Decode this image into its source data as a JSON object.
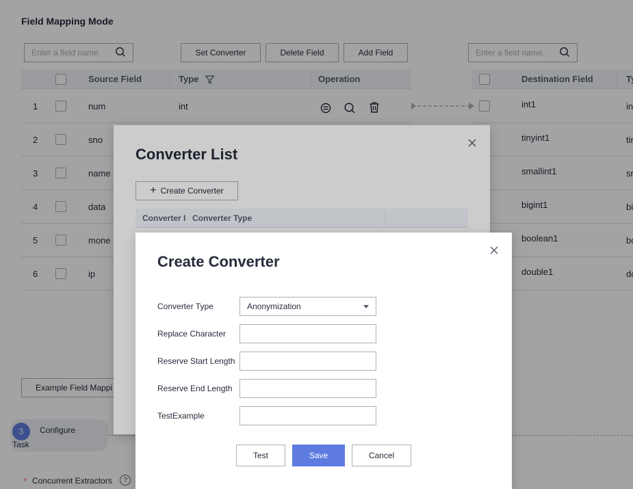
{
  "page": {
    "title": "Field Mapping Mode",
    "source_search_placeholder": "Enter a field name.",
    "dest_search_placeholder": "Enter a field name.",
    "toolbar": {
      "set_converter": "Set Converter",
      "delete_field": "Delete Field",
      "add_field": "Add Field"
    },
    "source_table": {
      "headers": {
        "source_field": "Source Field",
        "type": "Type",
        "operation": "Operation"
      },
      "rows": [
        {
          "index": "1",
          "field": "num",
          "type": "int"
        },
        {
          "index": "2",
          "field": "sno",
          "type": ""
        },
        {
          "index": "3",
          "field": "name",
          "type": ""
        },
        {
          "index": "4",
          "field": "data",
          "type": ""
        },
        {
          "index": "5",
          "field": "mone",
          "type": ""
        },
        {
          "index": "6",
          "field": "ip",
          "type": ""
        }
      ]
    },
    "dest_table": {
      "headers": {
        "destination_field": "Destination Field",
        "type": "Ty"
      },
      "rows": [
        {
          "field": "int1",
          "type": "in"
        },
        {
          "field": "tinyint1",
          "type": "tir"
        },
        {
          "field": "smallint1",
          "type": "sr"
        },
        {
          "field": "bigint1",
          "type": "bi"
        },
        {
          "field": "boolean1",
          "type": "bo"
        },
        {
          "field": "double1",
          "type": "do"
        }
      ]
    },
    "example_button": "Example Field Mappi",
    "step": {
      "number": "3",
      "label_line1": "Configure",
      "label_line2": "Task"
    },
    "concurrent": {
      "required_mark": "*",
      "label": "Concurrent Extractors",
      "help": "?"
    }
  },
  "converter_list_dialog": {
    "title": "Converter List",
    "create_button": "Create Converter",
    "columns": {
      "converter_name": "Converter I",
      "converter_type": "Converter Type"
    }
  },
  "create_converter_dialog": {
    "title": "Create Converter",
    "fields": {
      "converter_type": {
        "label": "Converter Type",
        "value": "Anonymization"
      },
      "replace_character": {
        "label": "Replace Character",
        "value": ""
      },
      "reserve_start_length": {
        "label": "Reserve Start Length",
        "value": ""
      },
      "reserve_end_length": {
        "label": "Reserve End Length",
        "value": ""
      },
      "test_example": {
        "label": "TestExample",
        "value": ""
      }
    },
    "buttons": {
      "test": "Test",
      "save": "Save",
      "cancel": "Cancel"
    }
  },
  "colors": {
    "primary": "#5e7ce0",
    "header_bg": "#f2f5fc",
    "border": "#adb0b8",
    "text": "#252b3a",
    "required": "#f66f6a"
  }
}
